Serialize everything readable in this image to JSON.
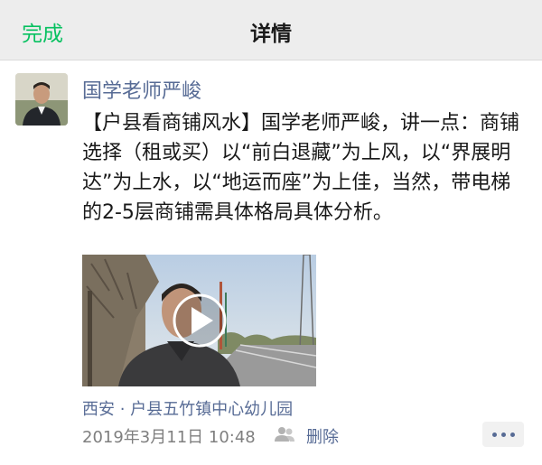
{
  "nav": {
    "done_label": "完成",
    "title": "详情"
  },
  "post": {
    "author": "国学老师严峻",
    "content": "【户县看商铺风水】国学老师严峻，讲一点：商铺选择（租或买）以“前白退藏”为上风，以“界展明达”为上水，以“地运而座”为上佳，当然，带电梯的2-5层商铺需具体格局具体分析。",
    "location": "西安 · 户县五竹镇中心幼儿园",
    "time": "2019年3月11日 10:48",
    "delete_label": "删除"
  },
  "colors": {
    "accent_green": "#07c160",
    "link_blue": "#576b95",
    "nav_bg": "#ededed"
  },
  "icons": {
    "play": "play-icon",
    "friends": "friends-icon",
    "more": "more-dots-icon"
  }
}
